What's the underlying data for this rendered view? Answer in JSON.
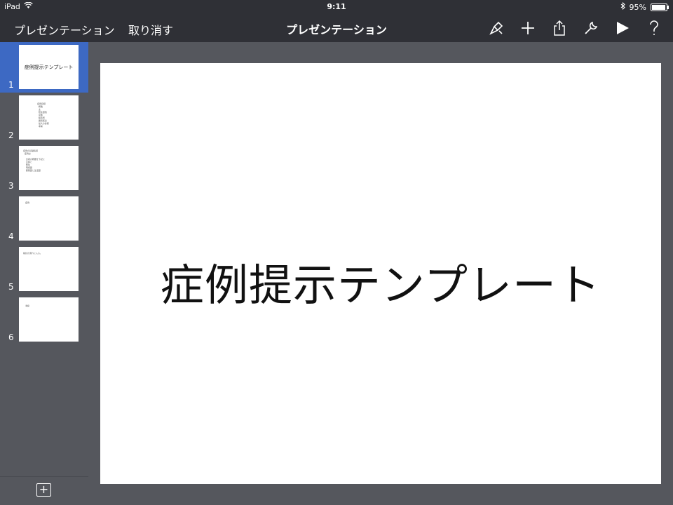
{
  "status": {
    "device": "iPad",
    "time": "9:11",
    "battery": "95%",
    "battery_level": 0.95
  },
  "toolbar": {
    "back_label": "プレゼンテーション",
    "undo_label": "取り消す",
    "title": "プレゼンテーション",
    "icons": [
      "format-brush-icon",
      "plus-icon",
      "share-icon",
      "wrench-icon",
      "play-icon",
      "help-icon"
    ]
  },
  "sidebar": {
    "slides": [
      {
        "number": "1",
        "title": "症例提示テンプレート",
        "selected": true
      },
      {
        "number": "2",
        "lines": "症例目標\n  概略\n  主\n  既往歴他\n  身体\n  検査所\n  鑑別疾患\n  最大の診断\n  考察"
      },
      {
        "number": "3",
        "lines": "症例の基礎情報\n  症例は\n\n    患者の概要を下記に\n    主訴と\n    既往\n    現病歴\n    服薬歴と生活歴"
      },
      {
        "number": "4",
        "lines": "症例"
      },
      {
        "number": "5",
        "lines": "検討の流れに入る。"
      },
      {
        "number": "6",
        "lines": "考察"
      }
    ]
  },
  "slide": {
    "title": "症例提示テンプレート"
  },
  "colors": {
    "chrome": "#2f3036",
    "background": "#55575d",
    "selected": "#3d69c3"
  }
}
